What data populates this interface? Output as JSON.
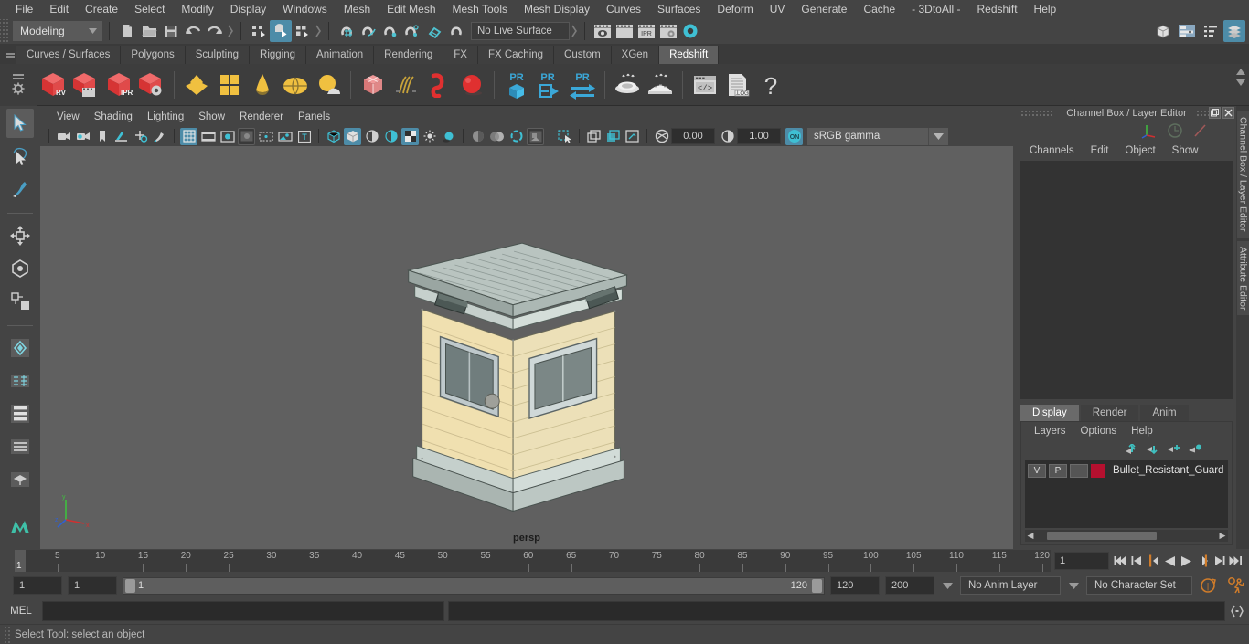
{
  "menubar": {
    "items": [
      "File",
      "Edit",
      "Create",
      "Select",
      "Modify",
      "Display",
      "Windows",
      "Mesh",
      "Edit Mesh",
      "Mesh Tools",
      "Mesh Display",
      "Curves",
      "Surfaces",
      "Deform",
      "UV",
      "Generate",
      "Cache",
      "- 3DtoAll -",
      "Redshift",
      "Help"
    ]
  },
  "statusline": {
    "menuset": "Modeling",
    "live_surface": "No Live Surface",
    "icons": [
      "new-scene-icon",
      "open-scene-icon",
      "save-scene-icon",
      "undo-icon",
      "redo-icon",
      "select-hierarchy-icon",
      "select-object-icon",
      "select-component-icon",
      "snap-to-grid-icon",
      "snap-to-curve-icon",
      "snap-to-point-icon",
      "snap-to-projected-center-icon",
      "snap-to-view-plane-icon",
      "make-live-icon",
      "render-view-icon",
      "render-current-frame-icon",
      "ipr-render-icon",
      "render-settings-icon",
      "hypershade-icon"
    ],
    "right_icons": [
      "show-hide-modeling-toolkit-icon",
      "show-hide-attribute-editor-icon",
      "show-hide-tool-settings-icon",
      "show-hide-channel-box-icon"
    ]
  },
  "shelf": {
    "tabs": [
      "Curves / Surfaces",
      "Polygons",
      "Sculpting",
      "Rigging",
      "Animation",
      "Rendering",
      "FX",
      "FX Caching",
      "Custom",
      "XGen",
      "Redshift"
    ],
    "active_tab": "Redshift",
    "icons": [
      {
        "name": "redshift-render-view-icon",
        "label": "RV"
      },
      {
        "name": "redshift-render-sequence-icon",
        "label": ""
      },
      {
        "name": "redshift-ipr-icon",
        "label": "IPR"
      },
      {
        "name": "redshift-render-settings-icon",
        "label": ""
      },
      {
        "name": "redshift-light-area-icon",
        "label": ""
      },
      {
        "name": "redshift-light-portal-icon",
        "label": ""
      },
      {
        "name": "redshift-light-ies-icon",
        "label": ""
      },
      {
        "name": "redshift-dome-light-icon",
        "label": ""
      },
      {
        "name": "redshift-physical-sun-sky-icon",
        "label": ""
      },
      {
        "name": "redshift-proxy-icon",
        "label": ""
      },
      {
        "name": "redshift-hair-icon",
        "label": ""
      },
      {
        "name": "redshift-volume-icon",
        "label": ""
      },
      {
        "name": "redshift-sphere-icon",
        "label": ""
      },
      {
        "name": "redshift-pr-object-icon",
        "label": "PR"
      },
      {
        "name": "redshift-pr-export-icon",
        "label": "PR"
      },
      {
        "name": "redshift-pr-transfer-icon",
        "label": "PR"
      },
      {
        "name": "redshift-bake-set-icon",
        "label": ""
      },
      {
        "name": "redshift-bake-render-icon",
        "label": ""
      },
      {
        "name": "redshift-script-editor-icon",
        "label": ""
      },
      {
        "name": "redshift-log-icon",
        "label": ".LOG"
      },
      {
        "name": "redshift-help-icon",
        "label": "?"
      }
    ]
  },
  "toolbox": {
    "tools": [
      "select-tool",
      "lasso-select-tool",
      "paint-select-tool",
      "move-tool",
      "rotate-tool",
      "scale-tool",
      "last-tool-used",
      "snap-x-icon",
      "layout-quad-icon",
      "layout-panes-icon",
      "layout-outliner-icon",
      "layout-persp-icon",
      "maya-logo-icon"
    ]
  },
  "viewport": {
    "menu": [
      "View",
      "Shading",
      "Lighting",
      "Show",
      "Renderer",
      "Panels"
    ],
    "camera_label": "persp",
    "toolbar": {
      "exposure": "0.00",
      "gamma": "1.00",
      "color_management": "sRGB gamma",
      "view_transform_on": "ON",
      "icons": [
        "select-camera-icon",
        "camera-attributes-icon",
        "bookmark-icon",
        "image-plane-icon",
        "two-d-pan-zoom-icon",
        "grease-pencil-icon",
        "grid-toggle-icon",
        "film-gate-icon",
        "resolution-gate-icon",
        "gate-mask-icon",
        "film-origin-icon",
        "exposure-icon",
        "xray-icon",
        "wireframe-shaded-icon",
        "smooth-shaded-icon",
        "shaded-textured-icon",
        "use-all-lights-icon",
        "shadows-icon",
        "screen-space-ao-icon",
        "motion-blur-icon",
        "multisample-icon",
        "depth-of-field-icon",
        "isolate-select-icon",
        "panel-single-icon",
        "panel-two-icon",
        "panel-four-icon",
        "camera-aperture-icon"
      ]
    }
  },
  "right_panel": {
    "title": "Channel Box / Layer Editor",
    "title_icons": [
      "axis-gizmo-icon",
      "clock-icon",
      "pen-icon"
    ],
    "menu": [
      "Channels",
      "Edit",
      "Object",
      "Show"
    ],
    "layer_tabs": [
      "Display",
      "Render",
      "Anim"
    ],
    "active_layer_tab": "Display",
    "layer_menu": [
      "Layers",
      "Options",
      "Help"
    ],
    "layer_buttons": [
      "move-layer-up-icon",
      "move-layer-down-icon",
      "new-layer-icon",
      "new-layer-from-selected-icon"
    ],
    "layers": [
      {
        "visibility": "V",
        "playback": "P",
        "shading": "",
        "color": "#b5102f",
        "name": "Bullet_Resistant_Guard"
      }
    ],
    "vertical_tabs": [
      "Channel Box / Layer Editor",
      "Attribute Editor"
    ]
  },
  "time_slider": {
    "ticks": [
      5,
      10,
      15,
      20,
      25,
      30,
      35,
      40,
      45,
      50,
      55,
      60,
      65,
      70,
      75,
      80,
      85,
      90,
      95,
      100,
      105,
      110,
      115,
      120
    ],
    "current_frame": "1",
    "current_frame_field": "1",
    "playback_buttons": [
      "go-to-start-icon",
      "step-back-key-icon",
      "step-back-frame-icon",
      "play-backwards-icon",
      "play-forwards-icon",
      "step-forward-frame-icon",
      "step-forward-key-icon",
      "go-to-end-icon"
    ]
  },
  "range_slider": {
    "anim_start": "1",
    "range_start": "1",
    "bar_min": "1",
    "bar_max": "120",
    "range_end": "120",
    "anim_end": "200",
    "anim_layer": "No Anim Layer",
    "character_set": "No Character Set",
    "right_icons": [
      "auto-keyframe-icon",
      "animation-preferences-icon"
    ]
  },
  "command_line": {
    "language": "MEL",
    "input_value": "",
    "output_value": "",
    "icon": "script-editor-icon"
  },
  "status_bar": {
    "help_text": "Select Tool: select an object"
  },
  "colors": {
    "accent_blue": "#4d8ca8",
    "shelf_bg": "#3d3d3d",
    "window_bg": "#444444",
    "viewport_bg": "#606060",
    "layer_red": "#b5102f",
    "orange": "#d07c2a"
  }
}
